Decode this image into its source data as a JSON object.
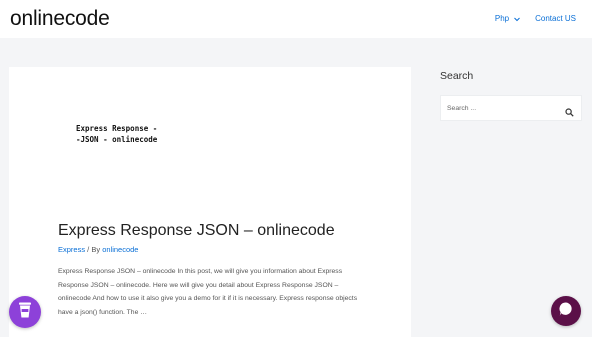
{
  "site": {
    "title": "onlinecode"
  },
  "nav": {
    "items": [
      {
        "label": "Php",
        "has_dropdown": true
      },
      {
        "label": "Contact US",
        "has_dropdown": false
      }
    ]
  },
  "post": {
    "thumbnail_text": "Express Response -\n-JSON - onlinecode",
    "title": "Express Response JSON – onlinecode",
    "category": "Express",
    "meta_sep": " / By ",
    "author": "onlinecode",
    "excerpt": "Express Response JSON – onlinecode In this post, we will give you information about Express Response JSON – onlinecode. Here we will give you detail about Express Response JSON – onlinecode And how to use it also give you a demo for it if it is necessary. Express response objects have a json() function. The …"
  },
  "sidebar": {
    "title": "Search",
    "search_placeholder": "Search ..."
  },
  "floating": {
    "left_icon": "coffee-cup-icon",
    "right_icon": "chat-bubble-icon"
  },
  "colors": {
    "accent": "#0a6fd6",
    "page_bg": "#f4f5f7",
    "cup_button": "#8d41d9",
    "chat_button": "#5b1048"
  }
}
